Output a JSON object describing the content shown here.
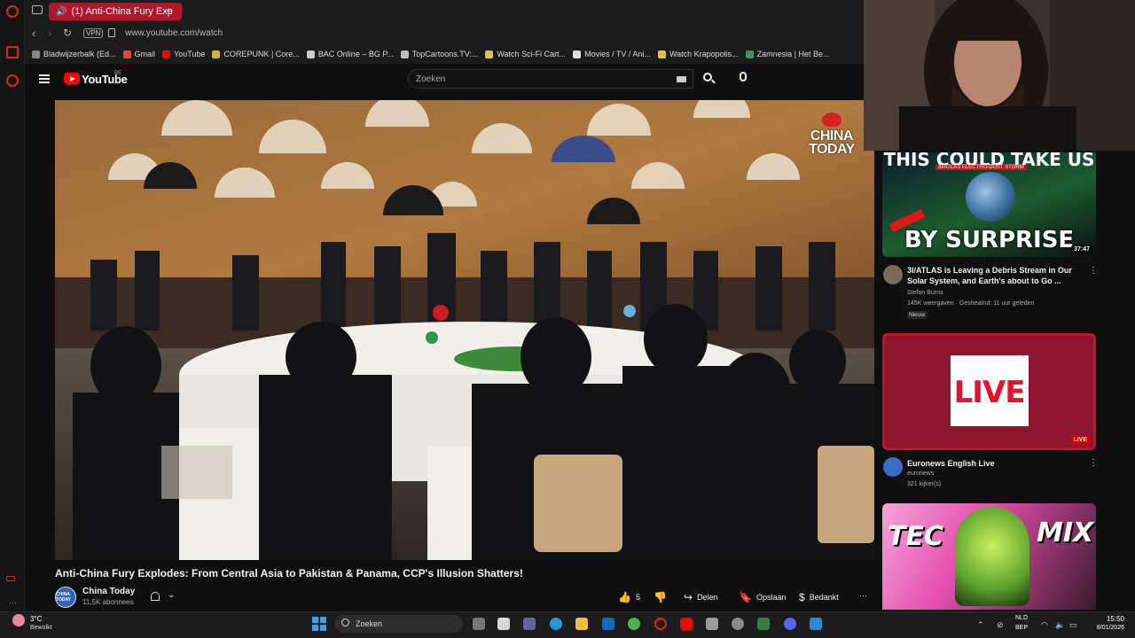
{
  "browser": {
    "active_tab_title": "(1) Anti-China Fury Exp",
    "new_tab_label": "+",
    "vpn_label": "VPN",
    "url": "www.youtube.com/watch",
    "bookmarks": [
      {
        "label": "Bladwijzerbalk (Ed...",
        "color": "#888888"
      },
      {
        "label": "Gmail",
        "color": "#ea4335"
      },
      {
        "label": "YouTube",
        "color": "#ff0000"
      },
      {
        "label": "COREPUNK | Core...",
        "color": "#e0b030"
      },
      {
        "label": "BAC Online – BG P...",
        "color": "#cccccc"
      },
      {
        "label": "TopCartoons.TV:...",
        "color": "#bbbbbb"
      },
      {
        "label": "Watch Sci-Fi Cart...",
        "color": "#e8c040"
      },
      {
        "label": "Movies / TV / Ani...",
        "color": "#dddddd"
      },
      {
        "label": "Watch Krapopolis...",
        "color": "#e8c040"
      },
      {
        "label": "Zamnesia | Het Be...",
        "color": "#3a9a5a"
      }
    ]
  },
  "youtube": {
    "logo_text": "YouTube",
    "region": "BE",
    "search_placeholder": "Zoeken"
  },
  "video": {
    "watermark_line1": "CHINA",
    "watermark_line2": "TODAY",
    "title": "Anti-China Fury Explodes: From Central Asia to Pakistan & Panama, CCP's Illusion Shatters!",
    "channel_name": "China Today",
    "channel_avatar_text": "CHINA TODAY",
    "subscribers": "11,5K abonnees",
    "like_count": "5",
    "share_label": "Delen",
    "save_label": "Opslaan",
    "thanks_label": "Bedankt",
    "more_label": "···"
  },
  "recommendations": [
    {
      "thumb_top_text": "THIS COULD TAKE US",
      "thumb_sub_text": "3I/ATLAS ELECTRO-DUST STORM",
      "thumb_bottom_text": "BY SURPRISE",
      "duration": "37:47",
      "title": "3I/ATLAS is Leaving a Debris Stream in Our Solar System, and Earth's about to Go ...",
      "channel": "Stefan Burns",
      "meta": "145K weergaven · Gestreamd: 11 uur geleden",
      "badge": "Nieuw"
    },
    {
      "thumb_text": "LIVE",
      "duration": "LIVE",
      "title": "Euronews English Live",
      "channel": "euronews",
      "meta": "321 kijker(s)"
    },
    {
      "thumb_left_text": "TEC",
      "thumb_right_text": "MIX"
    }
  ],
  "taskbar": {
    "weather_temp": "3°C",
    "weather_desc": "Bewolkt",
    "search_label": "Zoeken",
    "lang_line1": "NLD",
    "lang_line2": "BEP",
    "time": "15:50",
    "date": "8/01/2026"
  }
}
